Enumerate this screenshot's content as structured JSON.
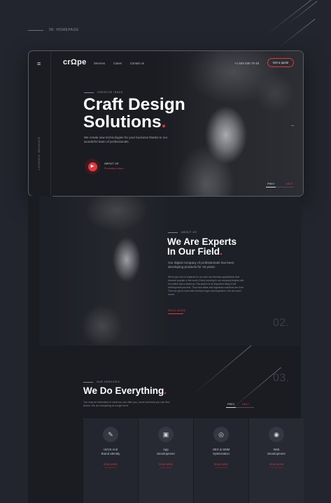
{
  "caption": {
    "text": "08. HOMEPAGE"
  },
  "hero": {
    "logo": "crΩpe",
    "menu_icon": "≡",
    "nav": [
      "Services",
      "Cases",
      "Contact us"
    ],
    "phone": "+1 845 635 78 45",
    "quote_button": "Get a quote",
    "rail_items": [
      "BEHANCE",
      "LINKEDIN"
    ],
    "eyebrow": "CREATIVE IDEAS",
    "title_line1": "Craft Design",
    "title_line2": "Solutions",
    "title_dot": ".",
    "description": "We create new technologies for your business thanks to our wonderful team of professionals.",
    "about_label": "ABOUT US",
    "promo_label": "Promotion video",
    "prev": "PREV",
    "next": "NEXT",
    "arrow": "→"
  },
  "about": {
    "eyebrow": "ABOUT US",
    "title_line1": "We Are Experts",
    "title_line2": "In Our Field",
    "title_dot": ".",
    "lead": "Our digital company of professionals has been developing products for 15 years.",
    "body": "We've got a lot of rewards for our web and develop applications that become popular in the world. Every morning in our company begins with hot coffee and a stand-up. Discussion is an important thing in the development process. Thus new ideas and ingenious solutions are born. Then we get to work with renewed vigor and inspiration. We are never bored.",
    "read_more": "READ MORE",
    "number": "02."
  },
  "services": {
    "eyebrow": "OUR SERVICES",
    "title": "We Do Everything",
    "title_dot": ".",
    "description": "You may be interested in what we can offer you, know services you can find below. We do everything at a high level.",
    "prev": "PREV",
    "next": "NEXT",
    "number": "03.",
    "cards": [
      {
        "icon": "✎",
        "title_line1": "UI/UX And",
        "title_line2": "Brand Identity",
        "more": "READ MORE"
      },
      {
        "icon": "▣",
        "title_line1": "App",
        "title_line2": "Development",
        "more": "READ MORE"
      },
      {
        "icon": "◎",
        "title_line1": "SEO & SMM",
        "title_line2": "Optimization",
        "more": "READ MORE"
      },
      {
        "icon": "◉",
        "title_line1": "Web",
        "title_line2": "Development",
        "more": "READ MORE"
      }
    ]
  }
}
